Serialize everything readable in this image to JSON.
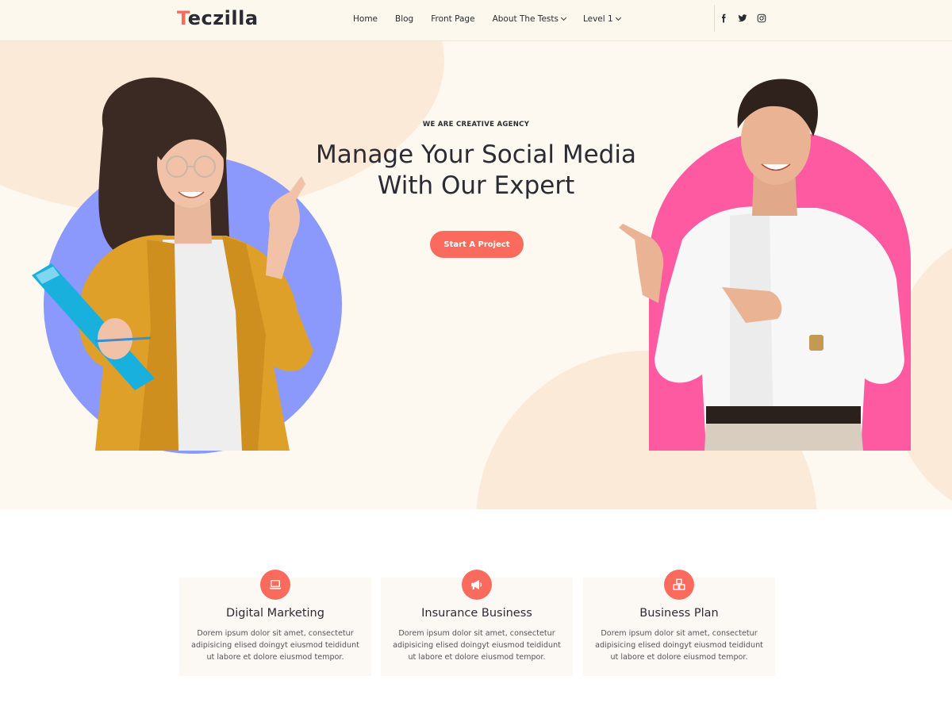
{
  "header": {
    "logo_initial": "T",
    "logo_rest": "eczilla",
    "nav": [
      {
        "label": "Home",
        "dropdown": false
      },
      {
        "label": "Blog",
        "dropdown": false
      },
      {
        "label": "Front Page",
        "dropdown": false
      },
      {
        "label": "About The Tests",
        "dropdown": true
      },
      {
        "label": "Level 1",
        "dropdown": true
      }
    ],
    "social": [
      "facebook-icon",
      "twitter-icon",
      "instagram-icon"
    ]
  },
  "hero": {
    "tagline": "WE ARE CREATIVE AGENCY",
    "headline_line1": "Manage Your Social Media",
    "headline_line2": "With Our Expert",
    "cta_label": "Start A Project"
  },
  "services": [
    {
      "icon": "laptop-icon",
      "title": "Digital Marketing",
      "text": "Dorem ipsum dolor sit amet, consectetur adipisicing elised doingyt eiusmod teididunt ut labore et dolore eiusmod tempor."
    },
    {
      "icon": "megaphone-icon",
      "title": "Insurance Business",
      "text": "Dorem ipsum dolor sit amet, consectetur adipisicing elised doingyt eiusmod teididunt ut labore et dolore eiusmod tempor."
    },
    {
      "icon": "cubes-icon",
      "title": "Business Plan",
      "text": "Dorem ipsum dolor sit amet, consectetur adipisicing elised doingyt eiusmod teididunt ut labore et dolore eiusmod tempor."
    }
  ],
  "colors": {
    "accent": "#fa6b5d",
    "hero_bg": "#fdf9f0",
    "purple": "#8b99fc",
    "pink": "#fe5aa2"
  }
}
